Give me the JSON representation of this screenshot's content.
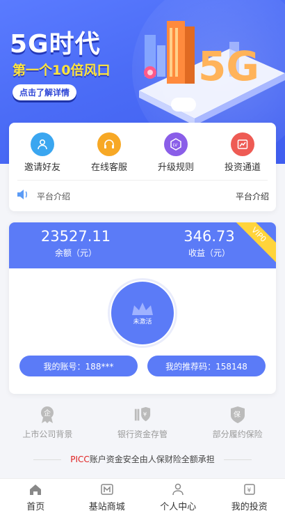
{
  "banner": {
    "title": "5G时代",
    "subtitle": "第一个10倍风口",
    "button": "点击了解详情"
  },
  "menu": [
    {
      "label": "邀请好友",
      "icon": "invite-user-icon",
      "color": "#3aa6f0"
    },
    {
      "label": "在线客服",
      "icon": "headset-icon",
      "color": "#f7a825"
    },
    {
      "label": "升级规则",
      "icon": "level-badge-icon",
      "color": "#8a5ee8"
    },
    {
      "label": "投资通道",
      "icon": "chart-icon",
      "color": "#ee5b54"
    }
  ],
  "notice": {
    "text": "平台介绍",
    "right": "平台介绍"
  },
  "balance": {
    "amount": "23527.11",
    "amount_label": "余额（元）",
    "income": "346.73",
    "income_label": "收益（元）",
    "vip": "VIP0",
    "status": "未激活",
    "account": "我的账号：188***",
    "referral": "我的推荐码：158148"
  },
  "guarantees": [
    {
      "label": "上市公司背景",
      "icon": "enterprise-badge-icon"
    },
    {
      "label": "银行资金存管",
      "icon": "bank-shield-icon"
    },
    {
      "label": "部分履约保险",
      "icon": "insurance-shield-icon"
    }
  ],
  "picc": {
    "brand": "PICC",
    "text": "账户资金安全由人保财险全额承担"
  },
  "tabs": [
    {
      "label": "首页",
      "icon": "home-icon"
    },
    {
      "label": "基站商城",
      "icon": "store-icon"
    },
    {
      "label": "个人中心",
      "icon": "user-icon"
    },
    {
      "label": "我的投资",
      "icon": "investment-icon"
    }
  ],
  "colors": {
    "primary": "#5b7bf7",
    "banner": "#4b6cf6",
    "vip": "#ffd43b",
    "subtitle": "#ffe53b",
    "picc": "#e02020"
  }
}
